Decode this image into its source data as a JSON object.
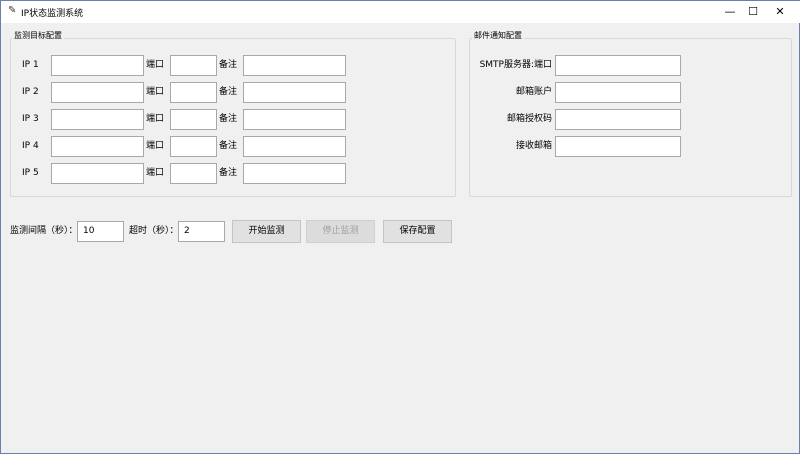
{
  "window": {
    "title": "IP状态监测系统",
    "minimize": "—",
    "maximize": "☐",
    "close": "✕"
  },
  "targets": {
    "title": "监测目标配置",
    "port_label": "端口",
    "remark_label": "备注",
    "rows": [
      {
        "label": "IP 1",
        "ip": "",
        "port": "",
        "remark": ""
      },
      {
        "label": "IP 2",
        "ip": "",
        "port": "",
        "remark": ""
      },
      {
        "label": "IP 3",
        "ip": "",
        "port": "",
        "remark": ""
      },
      {
        "label": "IP 4",
        "ip": "",
        "port": "",
        "remark": ""
      },
      {
        "label": "IP 5",
        "ip": "",
        "port": "",
        "remark": ""
      }
    ]
  },
  "mail": {
    "title": "邮件通知配置",
    "fields": [
      {
        "label": "SMTP服务器:端口",
        "value": ""
      },
      {
        "label": "邮箱账户",
        "value": ""
      },
      {
        "label": "邮箱授权码",
        "value": ""
      },
      {
        "label": "接收邮箱",
        "value": ""
      }
    ]
  },
  "controls": {
    "interval_label": "监测间隔（秒）：",
    "interval": "10",
    "timeout_label": "超时（秒）：",
    "timeout": "2",
    "start": "开始监测",
    "stop": "停止监测",
    "save": "保存配置"
  }
}
